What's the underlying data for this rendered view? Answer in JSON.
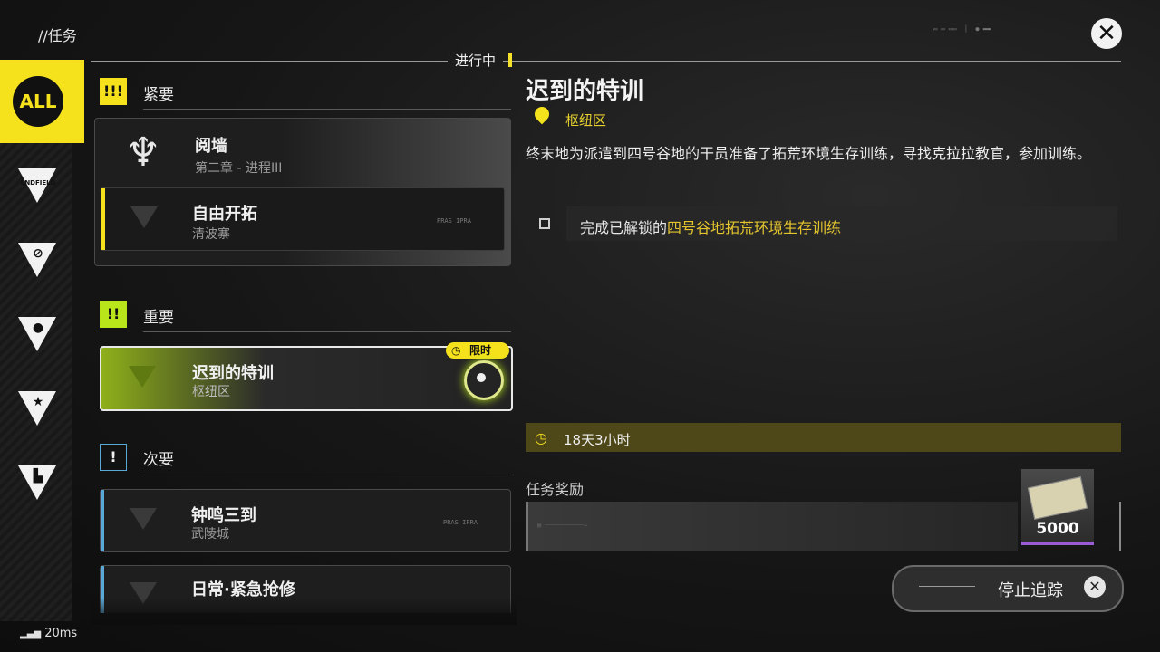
{
  "header": {
    "breadcrumb": "//任务",
    "close_icon": "close-icon",
    "in_progress_label": "进行中"
  },
  "sidenav": {
    "all_label": "ALL",
    "items": [
      {
        "name": "endfield",
        "label": "ENDFIELD"
      },
      {
        "name": "category-2",
        "label": ""
      },
      {
        "name": "category-3",
        "label": ""
      },
      {
        "name": "category-4",
        "label": ""
      },
      {
        "name": "category-5",
        "label": ""
      }
    ]
  },
  "sections": {
    "urgent": {
      "badge": "!!!",
      "title": "紧要"
    },
    "important": {
      "badge": "!!",
      "title": "重要"
    },
    "minor": {
      "badge": "!",
      "title": "次要"
    }
  },
  "quests": {
    "urgent_main": {
      "title": "阅墙",
      "subtitle": "第二章 - 进程III"
    },
    "urgent_sub": {
      "title": "自由开拓",
      "subtitle": "清波寨",
      "tag": "PRAS IPRA"
    },
    "important_1": {
      "title": "迟到的特训",
      "subtitle": "枢纽区",
      "badge": "限时"
    },
    "minor_1": {
      "title": "钟鸣三到",
      "subtitle": "武陵城",
      "tag": "PRAS IPRA"
    },
    "minor_2": {
      "title": "日常·紧急抢修",
      "subtitle": ""
    }
  },
  "detail": {
    "title": "迟到的特训",
    "location": "枢纽区",
    "description": "终末地为派遣到四号谷地的干员准备了拓荒环境生存训练，寻找克拉拉教官，参加训练。",
    "objective_prefix": "完成已解锁的",
    "objective_highlight": "四号谷地拓荒环境生存训练",
    "timer": "18天3小时",
    "reward_label": "任务奖励",
    "reward_qty": "5000",
    "stop_tracking": "停止追踪"
  },
  "status": {
    "ping": "20ms"
  },
  "colors": {
    "accent_yellow": "#f5e21c",
    "lime": "#b8e61a",
    "minor_blue": "#5aa8d8"
  }
}
